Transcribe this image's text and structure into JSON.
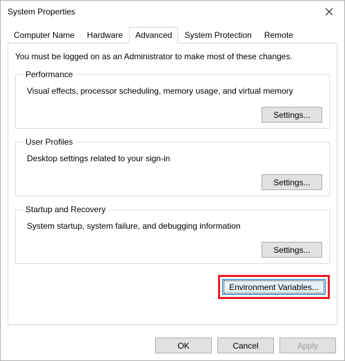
{
  "window": {
    "title": "System Properties"
  },
  "tabs": {
    "items": [
      {
        "label": "Computer Name"
      },
      {
        "label": "Hardware"
      },
      {
        "label": "Advanced"
      },
      {
        "label": "System Protection"
      },
      {
        "label": "Remote"
      }
    ],
    "active_index": 2
  },
  "advanced": {
    "intro": "You must be logged on as an Administrator to make most of these changes.",
    "performance": {
      "legend": "Performance",
      "desc": "Visual effects, processor scheduling, memory usage, and virtual memory",
      "settings_label": "Settings..."
    },
    "user_profiles": {
      "legend": "User Profiles",
      "desc": "Desktop settings related to your sign-in",
      "settings_label": "Settings..."
    },
    "startup": {
      "legend": "Startup and Recovery",
      "desc": "System startup, system failure, and debugging information",
      "settings_label": "Settings..."
    },
    "env_vars_label": "Environment Variables..."
  },
  "dialog_buttons": {
    "ok": "OK",
    "cancel": "Cancel",
    "apply": "Apply"
  }
}
